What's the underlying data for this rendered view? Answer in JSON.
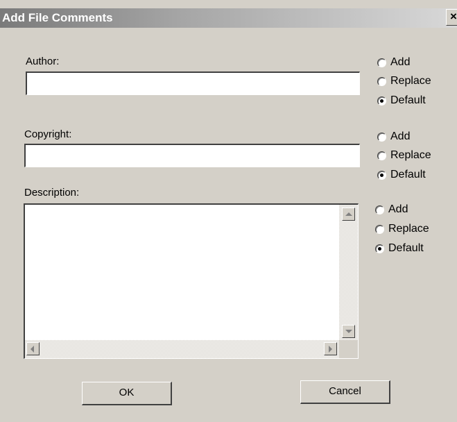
{
  "window": {
    "title": "Add File Comments",
    "close_glyph": "×"
  },
  "author": {
    "label": "Author:",
    "value": "",
    "options": [
      "Add",
      "Replace",
      "Default"
    ],
    "selected": "Default"
  },
  "copyright": {
    "label": "Copyright:",
    "value": "",
    "options": [
      "Add",
      "Replace",
      "Default"
    ],
    "selected": "Default"
  },
  "description": {
    "label": "Description:",
    "value": "",
    "options": [
      "Add",
      "Replace",
      "Default"
    ],
    "selected": "Default"
  },
  "buttons": {
    "ok": "OK",
    "cancel": "Cancel"
  }
}
